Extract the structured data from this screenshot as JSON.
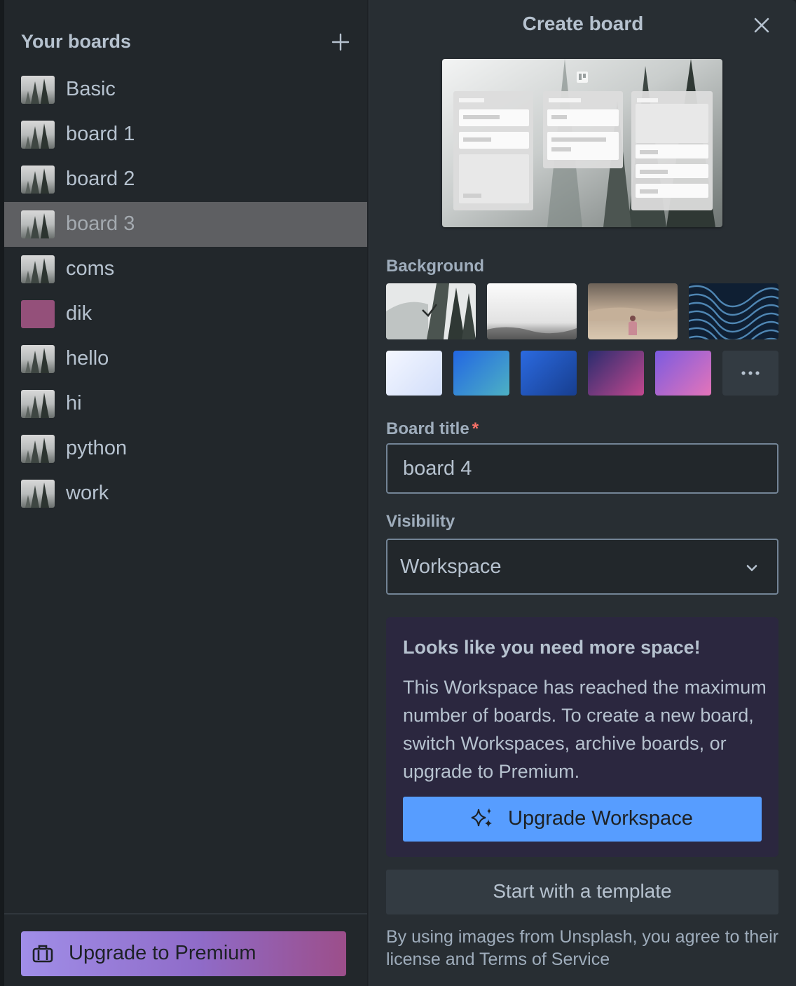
{
  "sidebar": {
    "title": "Your boards",
    "add_icon": "plus-icon",
    "boards": [
      {
        "label": "Basic",
        "thumb": "forest-image"
      },
      {
        "label": "board 1",
        "thumb": "forest-image"
      },
      {
        "label": "board 2",
        "thumb": "forest-image"
      },
      {
        "label": "board 3",
        "thumb": "forest-image",
        "active": true
      },
      {
        "label": "coms",
        "thumb": "forest-image"
      },
      {
        "label": "dik",
        "thumb": "color",
        "color": "#94507a"
      },
      {
        "label": "hello",
        "thumb": "forest-image"
      },
      {
        "label": "hi",
        "thumb": "forest-image"
      },
      {
        "label": "python",
        "thumb": "forest-image"
      },
      {
        "label": "work",
        "thumb": "forest-image"
      }
    ],
    "premium_button": {
      "label": "Upgrade to Premium",
      "icon": "briefcase-icon"
    }
  },
  "panel": {
    "title": "Create board",
    "close_icon": "close-icon",
    "background_label": "Background",
    "photo_backgrounds": [
      "snowy-forest",
      "foggy-landscape",
      "desert-person",
      "blue-waves"
    ],
    "selected_background": "snowy-forest",
    "color_backgrounds": [
      "#e4ecff",
      "#2c7be0",
      "#1f56c4",
      "#9b3f84",
      "#d26ab9"
    ],
    "more_icon": "more-icon",
    "title_field": {
      "label": "Board title",
      "required_mark": "*",
      "value": "board 4"
    },
    "visibility": {
      "label": "Visibility",
      "value": "Workspace",
      "icon": "chevron-down-icon"
    },
    "space_notice": {
      "heading": "Looks like you need more space!",
      "body": "This Workspace has reached the maximum number of boards. To create a new board, switch Workspaces, archive boards, or upgrade to Premium.",
      "button_label": "Upgrade Workspace",
      "button_icon": "sparkle-icon"
    },
    "template_button": "Start with a template",
    "footer_note": "By using images from Unsplash, you agree to their license and Terms of Service"
  }
}
